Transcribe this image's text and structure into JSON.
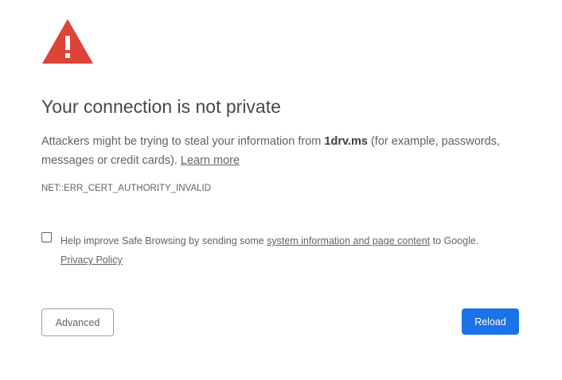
{
  "icon": {
    "name": "warning-icon",
    "color": "#db4437"
  },
  "title": "Your connection is not private",
  "explanation": {
    "before_host": "Attackers might be trying to steal your information from ",
    "host": "1drv.ms",
    "after_host": " (for example, passwords, messages or credit cards). ",
    "learn_more": "Learn more"
  },
  "error_code": "NET::ERR_CERT_AUTHORITY_INVALID",
  "safe_browsing": {
    "checked": false,
    "text_before": "Help improve Safe Browsing by sending some ",
    "link": "system information and page content",
    "text_after": " to Google.",
    "privacy_policy": "Privacy Policy"
  },
  "buttons": {
    "advanced": "Advanced",
    "reload": "Reload"
  },
  "colors": {
    "primary_button": "#1a73e8",
    "text": "#5f6368",
    "heading": "#202124"
  }
}
